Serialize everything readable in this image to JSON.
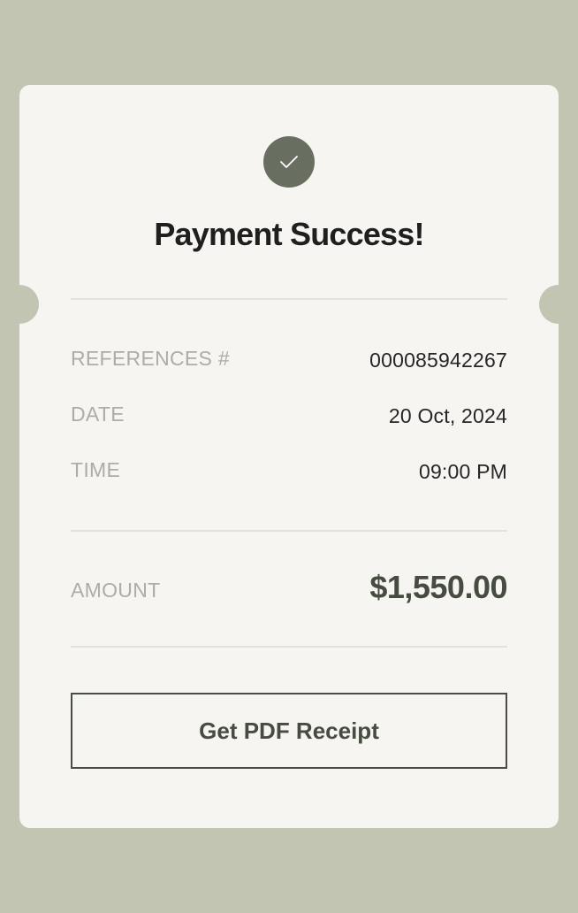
{
  "header": {
    "status_icon": "check-icon",
    "title": "Payment Success!"
  },
  "details": [
    {
      "label": "REFERENCES #",
      "value": "000085942267"
    },
    {
      "label": "DATE",
      "value": "20 Oct, 2024"
    },
    {
      "label": "TIME",
      "value": "09:00 PM"
    }
  ],
  "amount": {
    "label": "AMOUNT",
    "value": "$1,550.00"
  },
  "actions": {
    "pdf_receipt_label": "Get PDF Receipt"
  },
  "colors": {
    "background": "#c2c5b1",
    "card": "#f6f5f1",
    "accent": "#686e60",
    "amount": "#474c40"
  }
}
